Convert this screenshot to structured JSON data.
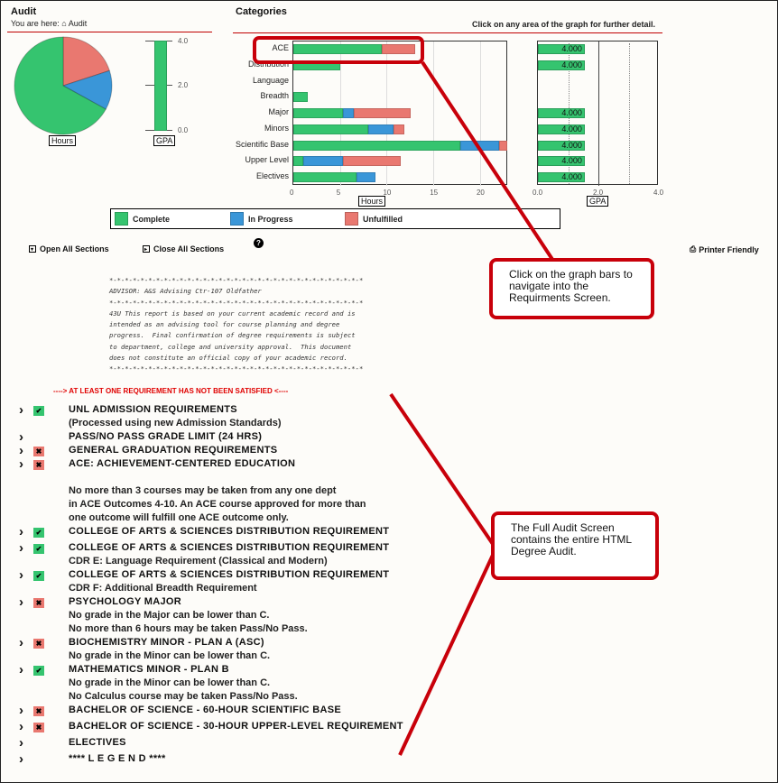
{
  "audit": {
    "title": "Audit",
    "breadcrumb_prefix": "You are here:",
    "breadcrumb_icon": "home-icon",
    "breadcrumb_current": "Audit",
    "hours_label": "Hours",
    "gpa_label": "GPA",
    "pie": {
      "slices": [
        {
          "name": "Complete",
          "fraction": 0.67,
          "color": "#35c46f"
        },
        {
          "name": "Unfulfilled",
          "fraction": 0.2,
          "color": "#e97870"
        },
        {
          "name": "In Progress",
          "fraction": 0.13,
          "color": "#3a96d8"
        }
      ]
    },
    "gpa_gauge": {
      "value": 4.0,
      "ticks": [
        "4.0",
        "2.0",
        "0.0"
      ],
      "max": 4.0
    }
  },
  "categories": {
    "title": "Categories",
    "hint": "Click on any area of the graph for further detail."
  },
  "legend": [
    {
      "label": "Complete",
      "color": "#35c46f"
    },
    {
      "label": "In Progress",
      "color": "#3a96d8"
    },
    {
      "label": "Unfulfilled",
      "color": "#e97870"
    }
  ],
  "chart_data": [
    {
      "type": "bar",
      "orientation": "horizontal",
      "stacked": true,
      "xlabel": "Hours",
      "xlim": [
        0,
        23
      ],
      "xticks": [
        "0",
        "5",
        "10",
        "15",
        "20"
      ],
      "categories": [
        "ACE",
        "Distribution",
        "Language",
        "Breadth",
        "Major",
        "Minors",
        "Scientific Base",
        "Upper Level",
        "Electives"
      ],
      "series": [
        {
          "name": "Complete",
          "color": "#35c46f",
          "values": [
            9.5,
            5,
            0,
            1.5,
            5.3,
            8,
            17.9,
            1.1,
            6.8
          ]
        },
        {
          "name": "In Progress",
          "color": "#3a96d8",
          "values": [
            0,
            0,
            0,
            0,
            1.2,
            2.7,
            4.1,
            4.2,
            2.0
          ]
        },
        {
          "name": "Unfulfilled",
          "color": "#e97870",
          "values": [
            3.5,
            0,
            0,
            0,
            6.1,
            1.2,
            0.9,
            6.2,
            0
          ]
        }
      ],
      "grid": true
    },
    {
      "type": "bar",
      "orientation": "horizontal",
      "xlabel": "GPA",
      "xlim": [
        0,
        4
      ],
      "xticks": [
        "0.0",
        "2.0",
        "4.0"
      ],
      "categories": [
        "ACE",
        "Distribution",
        "Language",
        "Breadth",
        "Major",
        "Minors",
        "Scientific Base",
        "Upper Level",
        "Electives"
      ],
      "values": [
        4.0,
        4.0,
        null,
        null,
        4.0,
        4.0,
        4.0,
        4.0,
        4.0
      ],
      "labels": [
        "4.000",
        "4.000",
        "",
        "",
        "4.000",
        "4.000",
        "4.000",
        "4.000",
        "4.000"
      ]
    }
  ],
  "toolbar": {
    "open_all": "Open All Sections",
    "close_all": "Close All Sections",
    "help_icon": "question-circle-icon",
    "printer_friendly": "Printer Friendly"
  },
  "advisor_block": "*-*-*-*-*-*-*-*-*-*-*-*-*-*-*-*-*-*-*-*-*-*-*-*-*-*-*-*-*-*-*-*-*\nADVISOR: A&S Advising Ctr-107 Oldfather\n*-*-*-*-*-*-*-*-*-*-*-*-*-*-*-*-*-*-*-*-*-*-*-*-*-*-*-*-*-*-*-*-*\n43U This report is based on your current academic record and is\nintended as an advising tool for course planning and degree\nprogress.  Final confirmation of degree requirements is subject\nto department, college and university approval.  This document\ndoes not constitute an official copy of your academic record.\n*-*-*-*-*-*-*-*-*-*-*-*-*-*-*-*-*-*-*-*-*-*-*-*-*-*-*-*-*-*-*-*-*",
  "warning": "----> AT LEAST ONE REQUIREMENT HAS NOT BEEN SATISFIED <----",
  "requirements": [
    {
      "title": "UNL ADMISSION REQUIREMENTS",
      "status": "complete",
      "notes": [
        "(Processed using new Admission Standards)"
      ]
    },
    {
      "title": "PASS/NO PASS GRADE LIMIT (24 HRS)",
      "status": "none",
      "notes": []
    },
    {
      "title": "GENERAL GRADUATION REQUIREMENTS",
      "status": "incomplete",
      "notes": []
    },
    {
      "title": "ACE: ACHIEVEMENT-CENTERED EDUCATION",
      "status": "incomplete",
      "notes": [
        "",
        "No more than 3 courses may be taken from any one dept",
        "in ACE Outcomes 4-10. An ACE course approved for more than",
        "one outcome will fulfill one ACE outcome only."
      ]
    },
    {
      "title": "COLLEGE OF ARTS & SCIENCES DISTRIBUTION REQUIREMENT",
      "status": "complete",
      "notes": []
    },
    {
      "title": "COLLEGE OF ARTS & SCIENCES DISTRIBUTION REQUIREMENT",
      "status": "complete",
      "notes": [
        "CDR E: Language Requirement (Classical and Modern)"
      ]
    },
    {
      "title": "COLLEGE OF ARTS & SCIENCES DISTRIBUTION REQUIREMENT",
      "status": "complete",
      "notes": [
        "CDR F: Additional Breadth Requirement"
      ]
    },
    {
      "title": "PSYCHOLOGY MAJOR",
      "status": "incomplete",
      "notes": [
        "No grade in the Major can be lower than C.",
        "No more than 6 hours may be taken Pass/No Pass."
      ]
    },
    {
      "title": "BIOCHEMISTRY MINOR - PLAN A (ASC)",
      "status": "incomplete",
      "notes": [
        "No grade in the Minor can be lower than C."
      ]
    },
    {
      "title": "MATHEMATICS MINOR - PLAN B",
      "status": "complete",
      "notes": [
        "No grade in the Minor can be lower than C.",
        "No Calculus course may be taken Pass/No Pass."
      ]
    },
    {
      "title": "BACHELOR OF SCIENCE - 60-HOUR SCIENTIFIC BASE",
      "status": "incomplete",
      "notes": []
    },
    {
      "title": "BACHELOR OF SCIENCE - 30-HOUR UPPER-LEVEL REQUIREMENT",
      "status": "incomplete",
      "notes": []
    },
    {
      "title": "ELECTIVES",
      "status": "none",
      "notes": []
    },
    {
      "title": "**** L E G E N D ****",
      "status": "none",
      "notes": []
    }
  ],
  "status_colors": {
    "complete": "#35c46f",
    "incomplete": "#e97870"
  },
  "callouts": [
    {
      "text": "Click on the graph bars to navigate into the Requirments Screen."
    },
    {
      "text": "The Full Audit Screen contains the entire HTML Degree Audit."
    }
  ],
  "annotation_color": "#c8000a"
}
